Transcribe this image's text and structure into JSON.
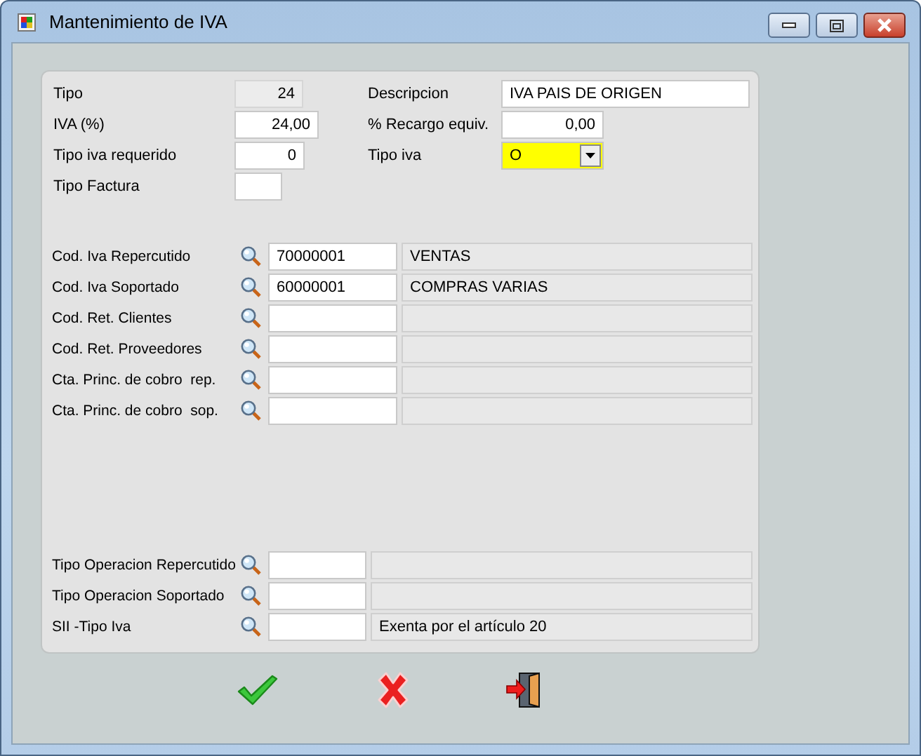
{
  "window": {
    "title": "Mantenimiento de IVA"
  },
  "top_rows": [
    {
      "left": {
        "label": "Tipo",
        "value": "24",
        "kind": "readonly"
      },
      "right": {
        "label": "Descripcion",
        "value": "IVA PAIS DE ORIGEN",
        "kind": "text"
      }
    },
    {
      "left": {
        "label": "IVA (%)",
        "value": "24,00",
        "kind": "number"
      },
      "right": {
        "label": "% Recargo equiv.",
        "value": "0,00",
        "kind": "number"
      }
    },
    {
      "left": {
        "label": "Tipo iva requerido",
        "value": "0",
        "kind": "number"
      },
      "right": {
        "label": "Tipo iva",
        "value": "O",
        "kind": "select",
        "highlighted": true
      }
    },
    {
      "left": {
        "label": "Tipo Factura",
        "kind": "text"
      }
    }
  ],
  "lookups": [
    {
      "label": "Cod. Iva Repercutido",
      "code": "70000001",
      "description": "VENTAS"
    },
    {
      "label": "Cod. Iva Soportado",
      "code": "60000001",
      "description": "COMPRAS VARIAS"
    },
    {
      "label": "Cod. Ret. Clientes"
    },
    {
      "label": "Cod. Ret. Proveedores"
    },
    {
      "label": "Cta. Princ. de cobro  rep."
    },
    {
      "label": "Cta. Princ. de cobro  sop."
    }
  ],
  "sii_lookups": [
    {
      "label": "Tipo Operacion Repercutido"
    },
    {
      "label": "Tipo Operacion Soportado"
    },
    {
      "label": "SII -Tipo Iva",
      "description": "Exenta por el artículo 20"
    }
  ],
  "buttons": [
    {
      "kind": "accept"
    },
    {
      "kind": "cancel"
    },
    {
      "kind": "exit"
    }
  ]
}
